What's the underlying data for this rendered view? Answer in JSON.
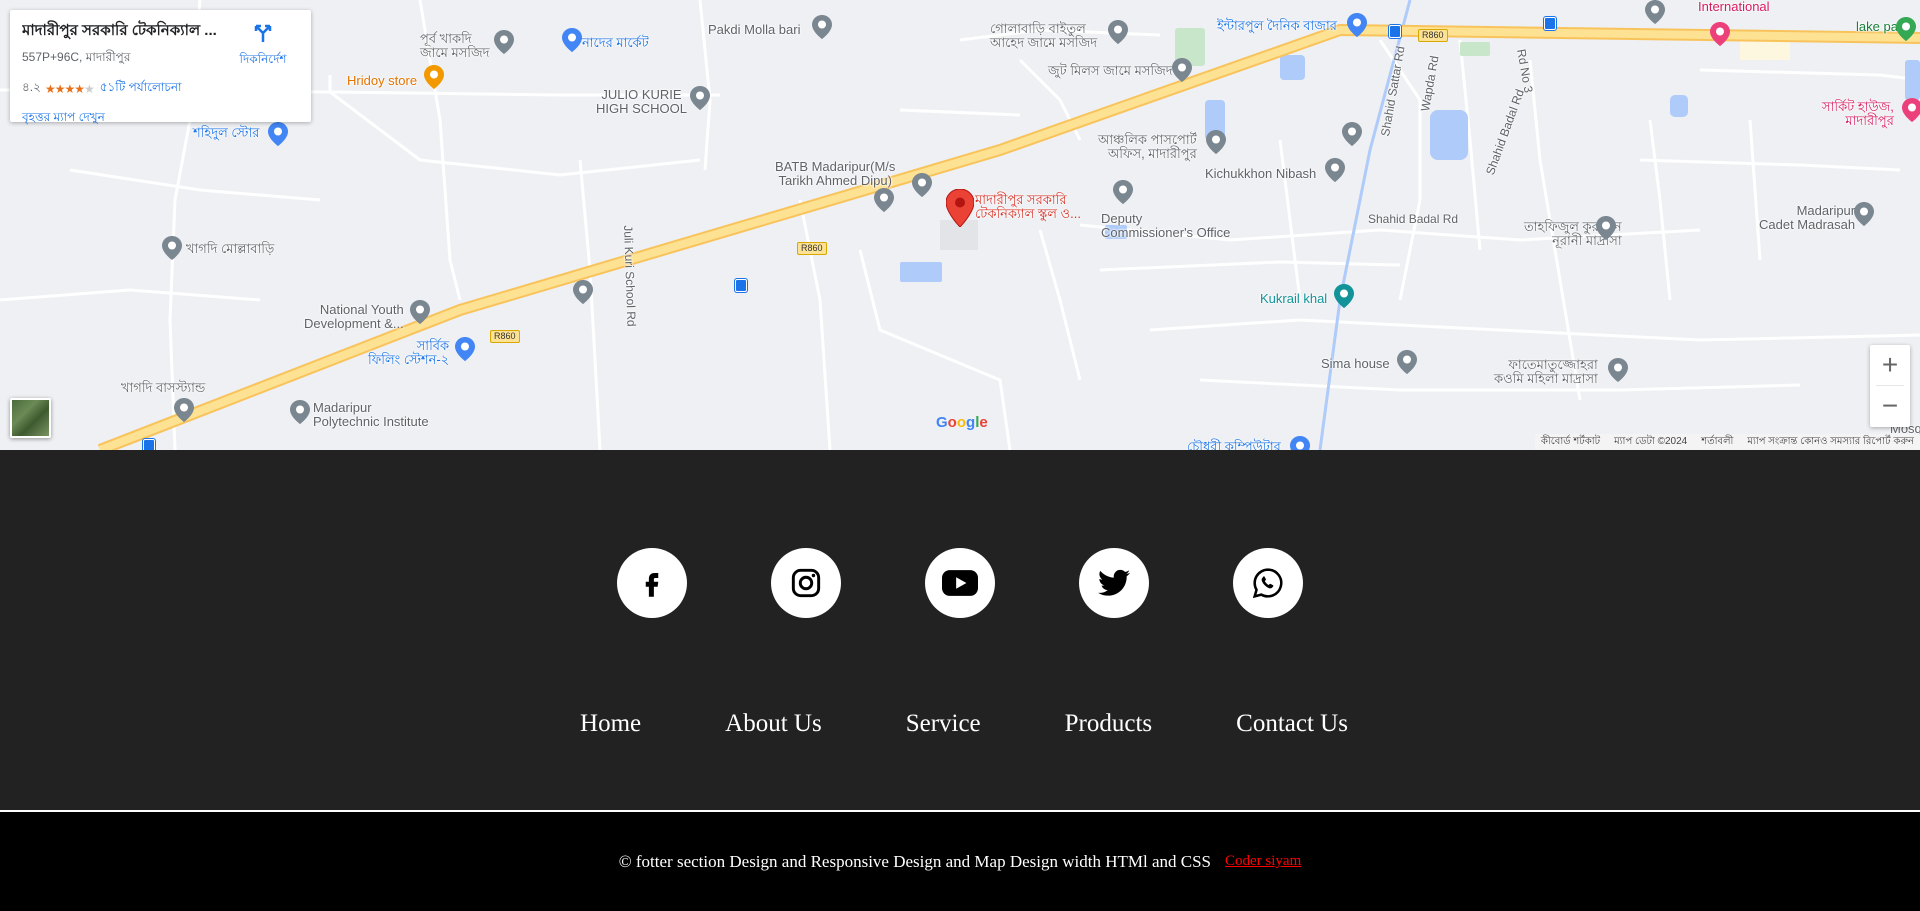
{
  "map": {
    "info_card": {
      "title": "মাদারীপুর সরকারি টেকনিক্যাল ...",
      "address": "557P+96C, মাদারীপুর",
      "rating": "৪.২",
      "rating_value": 4.2,
      "reviews": "৫১টি পর্যালোচনা",
      "directions_label": "দিকনির্দেশ",
      "bigger_map_label": "বৃহত্তর ম্যাপ দেখুন"
    },
    "marker_label_line1": "মাদারীপুর সরকারি",
    "marker_label_line2": "টেকনিক্যাল স্কুল ও...",
    "places": {
      "purba_khakdi_1": "পূর্ব খাকদি",
      "purba_khakdi_2": "জামে মসজিদ",
      "nader_market": "নাদের মার্কেট",
      "pakdi_molla_bari": "Pakdi Molla bari",
      "golabari_1": "গোলাবাড়ি বাইতুল",
      "golabari_2": "আহেদ জামে মসজিদ",
      "interpool": "ইন্টারপুল দৈনিক বাজার",
      "international": "International",
      "lake_park": "lake park",
      "hridoy_store": "Hridoy store",
      "jute_mills": "জুট মিলস জামে মসজিদ",
      "julio_1": "JULIO KURIE",
      "julio_2": "HIGH SCHOOL",
      "shohidul_store": "শহিদুল স্টোর",
      "circuit_house_1": "সার্কিট হাউজ,",
      "circuit_house_2": "মাদারীপুর",
      "batb_1": "BATB Madaripur(M/s",
      "batb_2": "Tarikh Ahmed Dipu)",
      "passport_1": "আঞ্চলিক পাসপোর্ট",
      "passport_2": "অফিস, মাদারীপুর",
      "kichukkhon": "Kichukkhon Nibash",
      "madaripur_cadet_1": "Madaripur",
      "madaripur_cadet_2": "Cadet Madrasah",
      "deputy_1": "Deputy",
      "deputy_2": "Commissioner's Office",
      "tahfijul_1": "তাহফিজুল কুরআন",
      "tahfijul_2": "নূরানী মাদ্রাসা",
      "khagdi_mollabari": "খাগদি মোল্লাবাড়ি",
      "kukrail_khal": "Kukrail khal",
      "nyd_1": "National Youth",
      "nyd_2": "Development &...",
      "sarbik_1": "সার্বিক",
      "sarbik_2": "ফিলিং স্টেশন-২",
      "sima_house": "Sima house",
      "fatematuz_1": "ফাতেমাতুজ্জোহরা",
      "fatematuz_2": "কওমি মহিলা মাদ্রাসা",
      "khagdi_bus": "খাগদি বাসস্ট্যান্ড",
      "poly_1": "Madaripur",
      "poly_2": "Polytechnic Institute",
      "chowdhury": "চৌধুরী কম্পিউটার",
      "mosq": "Mosq"
    },
    "roads": {
      "juli_kuri": "Juli Kuri School Rd",
      "shahid_sattar": "Shahid Sattar Rd",
      "wapda": "Wapda Rd",
      "rd_no_3": "Rd No 3",
      "shahid_badal_1": "Shahid Badal Rd",
      "shahid_badal_2": "Shahid Badal Rd",
      "r860": "R860"
    },
    "google_logo": [
      "G",
      "o",
      "o",
      "g",
      "l",
      "e"
    ],
    "google_colors": [
      "#4285F4",
      "#EA4335",
      "#FBBC05",
      "#4285F4",
      "#34A853",
      "#EA4335"
    ],
    "zoom_in": "+",
    "zoom_out": "−",
    "attribution": {
      "keyboard": "কীবোর্ড শর্টকাট",
      "map_data": "ম্যাপ ডেটা ©2024",
      "terms": "শর্তাবলী",
      "report": "ম্যাপ সংক্রান্ত কোনও সমস্যার রিপোর্ট করুন"
    }
  },
  "footer": {
    "social": [
      {
        "name": "facebook",
        "icon": "facebook-icon"
      },
      {
        "name": "instagram",
        "icon": "instagram-icon"
      },
      {
        "name": "youtube",
        "icon": "youtube-icon"
      },
      {
        "name": "twitter",
        "icon": "twitter-icon"
      },
      {
        "name": "whatsapp",
        "icon": "whatsapp-icon"
      }
    ],
    "nav": {
      "home": "Home",
      "about": "About Us",
      "service": "Service",
      "products": "Products",
      "contact": "Contact Us"
    },
    "copyright": "© fotter section Design and Responsive Design and Map Design width HTMl and CSS",
    "author": "Coder siyam",
    "colors": {
      "footer_bg": "#222222",
      "bottom_bg": "#000000",
      "author": "#ff0000"
    }
  }
}
